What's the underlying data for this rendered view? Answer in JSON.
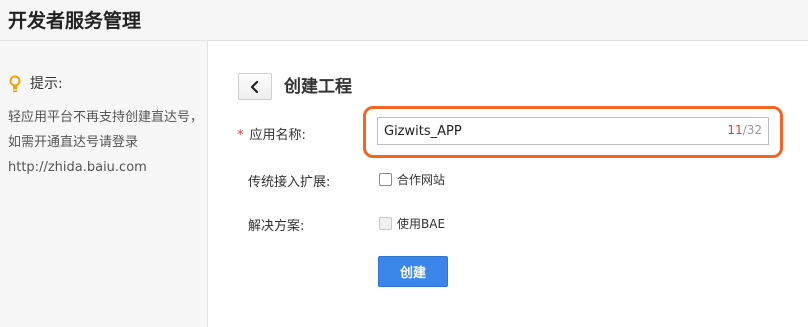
{
  "header": {
    "title": "开发者服务管理"
  },
  "sidebar": {
    "tip_label": "提示:",
    "tip_text": "轻应用平台不再支持创建直达号，如需开通直达号请登录http://zhida.baiu.com",
    "tip_icon": "lightbulb-icon",
    "accent": "#f0a30a"
  },
  "main": {
    "back_icon": "chevron-left-icon",
    "page_title": "创建工程",
    "app_name": {
      "required_mark": "*",
      "label": "应用名称:",
      "value": "Gizwits_APP",
      "count": "11",
      "max": "/32"
    },
    "extension": {
      "label": "传统接入扩展:",
      "option": "合作网站",
      "checked": false
    },
    "solution": {
      "label": "解决方案:",
      "option": "使用BAE",
      "checked": false,
      "disabled": true
    },
    "submit_label": "创建"
  },
  "colors": {
    "highlight": "#f26522",
    "primary": "#3a86e8",
    "required": "#e4393c"
  }
}
